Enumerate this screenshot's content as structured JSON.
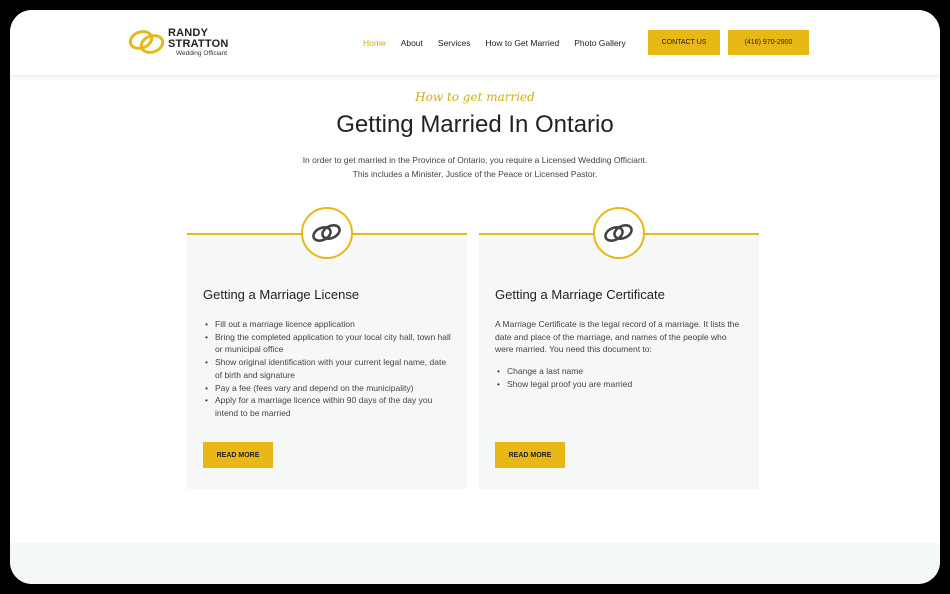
{
  "header": {
    "logo": {
      "line1": "RANDY",
      "line2": "STRATTON",
      "sub": "Wedding Officiant"
    },
    "nav": [
      {
        "label": "Home",
        "active": true
      },
      {
        "label": "About",
        "active": false
      },
      {
        "label": "Services",
        "active": false
      },
      {
        "label": "How to Get Married",
        "active": false
      },
      {
        "label": "Photo Gallery",
        "active": false
      }
    ],
    "contact_label": "CONTACT US",
    "phone_label": "(416) 970-2900"
  },
  "hero": {
    "eyebrow": "How to get married",
    "title": "Getting Married In Ontario",
    "intro_line1": "In order to get married in the Province of Ontario, you require a Licensed Wedding Officiant.",
    "intro_line2": "This includes a Minister, Justice of the Peace or Licensed Pastor."
  },
  "cards": [
    {
      "icon": "wedding-rings-icon",
      "title": "Getting a Marriage License",
      "paragraph": "",
      "items": [
        "Fill out a marriage licence application",
        "Bring the completed application to your local city hall, town hall or municipal office",
        "Show original identification with your current legal name, date of birth and signature",
        "Pay a fee (fees vary and depend on the municipality)",
        "Apply for a marriage licence within 90 days of the day you intend to be married"
      ],
      "button": "READ MORE"
    },
    {
      "icon": "wedding-rings-icon",
      "title": "Getting a Marriage Certificate",
      "paragraph": "A Marriage Certificate is the legal record of a marriage. It lists the date and place of the marriage, and names of the people who were married. You need this document to:",
      "items": [
        "Change a last name",
        "Show legal proof you are married"
      ],
      "button": "READ MORE"
    }
  ],
  "colors": {
    "accent": "#e8b816",
    "accent_text": "#d9aa12",
    "card_bg": "#f6f8f8"
  }
}
